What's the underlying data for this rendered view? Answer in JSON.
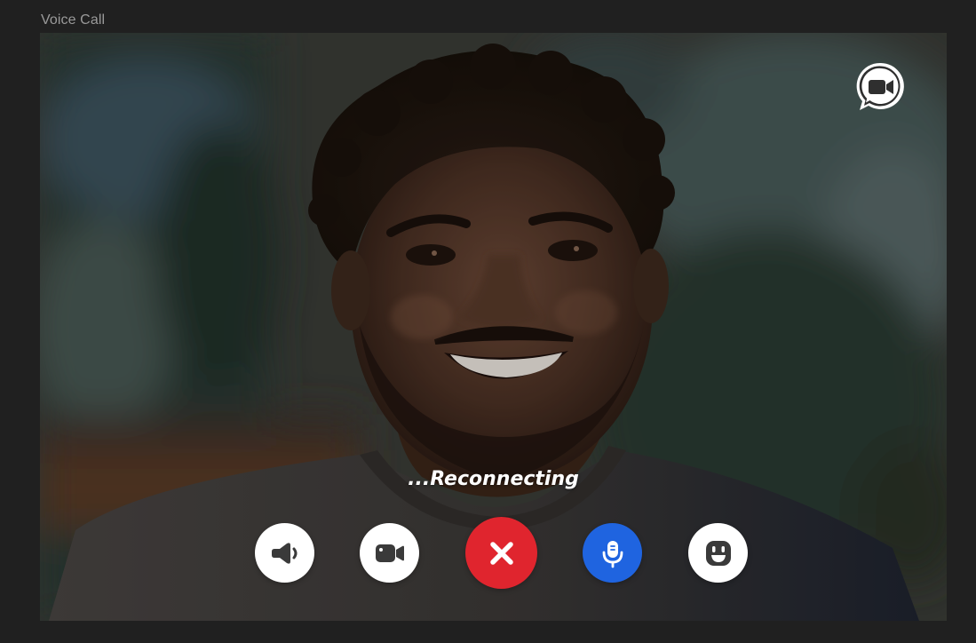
{
  "page": {
    "title": "Voice Call"
  },
  "call": {
    "status": "...Reconnecting"
  },
  "controls": [
    {
      "name": "speaker-button",
      "icon": "speaker-icon"
    },
    {
      "name": "camera-button",
      "icon": "video-camera-icon"
    },
    {
      "name": "end-call-button",
      "icon": "close-icon"
    },
    {
      "name": "mute-button",
      "icon": "microphone-icon"
    },
    {
      "name": "emoji-button",
      "icon": "emoji-icon"
    }
  ],
  "top_action": {
    "name": "video-chat-button",
    "icon": "video-chat-bubble-icon"
  },
  "colors": {
    "hangup": "#e0252e",
    "mic_active": "#1f64e0",
    "button_bg": "#ffffff",
    "icon_dark": "#3a3a3a"
  }
}
